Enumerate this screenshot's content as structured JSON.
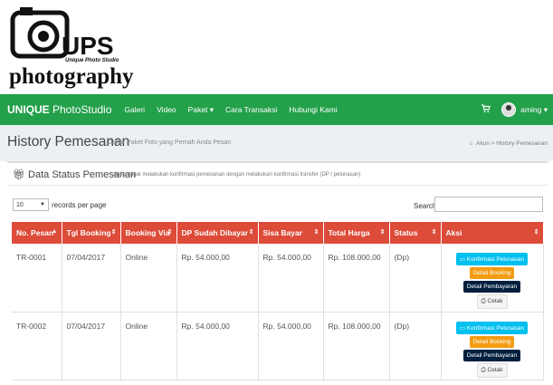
{
  "logo": {
    "brand": "UPS",
    "tagline": "Unique Photo Studio",
    "word": "photography"
  },
  "navbar": {
    "brand_bold": "UNIQUE",
    "brand_rest": " PhotoStudio",
    "items": [
      {
        "label": "Galeri"
      },
      {
        "label": "Video"
      },
      {
        "label": "Paket ▾"
      },
      {
        "label": "Cara Transaksi"
      },
      {
        "label": "Hubungi Kami"
      }
    ],
    "cart_icon": "cart-icon",
    "user": "aming ▾"
  },
  "page": {
    "title": "History Pemesanan",
    "subtitle": "Daftar Paket Foto yang Pernah Anda Pesan",
    "breadcrumb": "Akun  >  History Pemesanan"
  },
  "box": {
    "title": "Data Status Pemesanan",
    "subtitle": "Anda dapat melakukan konfirmasi pemesanan dengan melakukan konfirmasi transfer (DP / pelunasan)"
  },
  "table_controls": {
    "length_value": "10",
    "length_label": "records per page",
    "search_label": "Search:",
    "search_value": ""
  },
  "table": {
    "headers": [
      "No. Pesan",
      "Tgl Booking",
      "Booking Via",
      "DP Sudah Dibayar",
      "Sisa Bayar",
      "Total Harga",
      "Status",
      "Aksi"
    ],
    "rows": [
      {
        "no": "TR-0001",
        "tgl": "07/04/2017",
        "via": "Online",
        "dp": "Rp. 54.000,00",
        "sisa": "Rp. 54.000,00",
        "total": "Rp. 108.000,00",
        "status": "(Dp)"
      },
      {
        "no": "TR-0002",
        "tgl": "07/04/2017",
        "via": "Online",
        "dp": "Rp. 54.000,00",
        "sisa": "Rp. 54.000,00",
        "total": "Rp. 108.000,00",
        "status": "(Dp)"
      }
    ],
    "actions": {
      "konfirmasi": "Konfirmasi Pelunasan",
      "detail_booking": "Detail Booking",
      "detail_pembayaran": "Detail Pembayaran",
      "cetak": "Cetak"
    }
  },
  "colors": {
    "navbar": "#23a04a",
    "table_header": "#dd4b39",
    "btn_konfirmasi": "#00c0ef",
    "btn_booking": "#f39c12",
    "btn_pembayaran": "#001f3f"
  }
}
